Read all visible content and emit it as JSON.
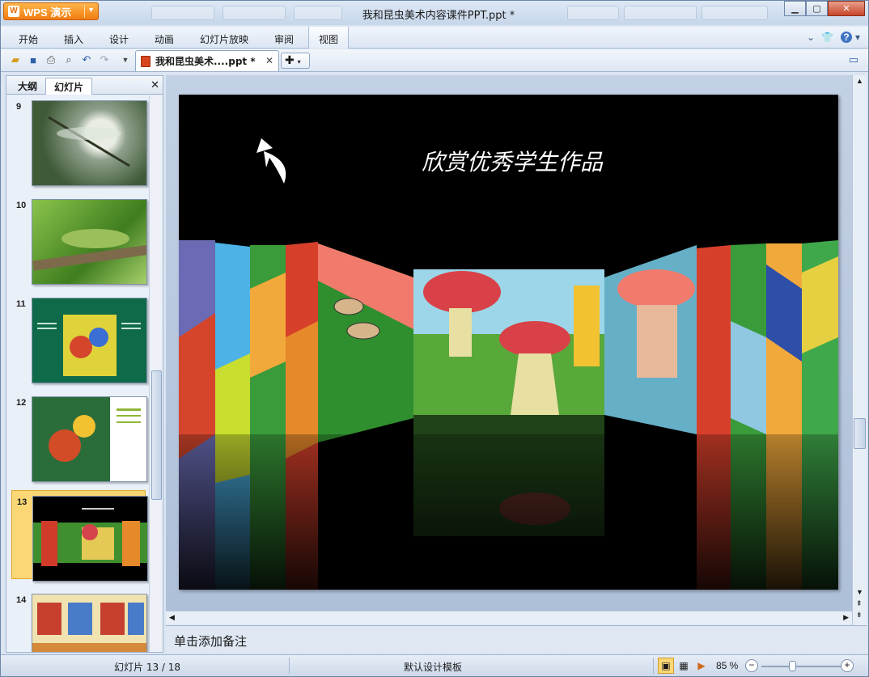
{
  "app": {
    "name": "WPS 演示",
    "window_title": "我和昆虫美术内容课件PPT.ppt *"
  },
  "menu": [
    "开始",
    "插入",
    "设计",
    "动画",
    "幻灯片放映",
    "审阅",
    "视图"
  ],
  "document_tab": {
    "name": "我和昆虫美术....ppt *"
  },
  "left_panel": {
    "tabs": [
      "大纲",
      "幻灯片"
    ],
    "active_tab": "幻灯片",
    "thumbnails": [
      {
        "number": "9"
      },
      {
        "number": "10"
      },
      {
        "number": "11"
      },
      {
        "number": "12"
      },
      {
        "number": "13",
        "selected": true
      },
      {
        "number": "14"
      }
    ]
  },
  "slide": {
    "title": "欣赏优秀学生作品"
  },
  "notes": {
    "placeholder": "单击添加备注"
  },
  "status": {
    "slide_indicator": "幻灯片 13 / 18",
    "template": "默认设计模板",
    "zoom": "85 %"
  },
  "colors": {
    "accent": "#f07d10",
    "selected_thumb": "#fbd775"
  }
}
